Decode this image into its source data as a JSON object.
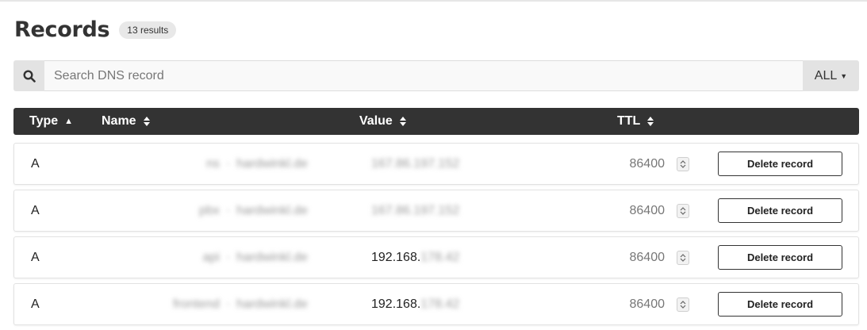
{
  "header": {
    "title": "Records",
    "results_badge": "13 results"
  },
  "search": {
    "placeholder": "Search DNS record",
    "value": "",
    "filter_label": "ALL"
  },
  "table": {
    "columns": {
      "type": "Type",
      "name": "Name",
      "value": "Value",
      "ttl": "TTL"
    },
    "rows": [
      {
        "type": "A",
        "name_sub": "ns",
        "name_domain": "hardwinkl.de",
        "value_plain": "",
        "value_hidden": "167.86.197.152",
        "ttl": "86400",
        "action": "Delete record"
      },
      {
        "type": "A",
        "name_sub": "pbx",
        "name_domain": "hardwinkl.de",
        "value_plain": "",
        "value_hidden": "167.86.197.152",
        "ttl": "86400",
        "action": "Delete record"
      },
      {
        "type": "A",
        "name_sub": "api",
        "name_domain": "hardwinkl.de",
        "value_plain": "192.168.",
        "value_hidden": "178.42",
        "ttl": "86400",
        "action": "Delete record"
      },
      {
        "type": "A",
        "name_sub": "frontend",
        "name_domain": "hardwinkl.de",
        "value_plain": "192.168.",
        "value_hidden": "178.42",
        "ttl": "86400",
        "action": "Delete record"
      }
    ]
  },
  "colors": {
    "header_bg": "#333333",
    "search_bg": "#e3e3e3",
    "ttl_text": "#777777"
  },
  "icons": {
    "search": "search-icon",
    "sort_asc": "sort-ascending-icon",
    "sort": "sort-icon",
    "stepper": "stepper-icon"
  }
}
